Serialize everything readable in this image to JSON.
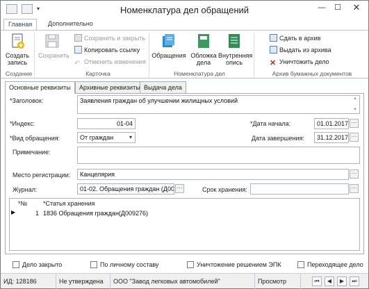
{
  "window": {
    "title": "Номенклатура дел обращений"
  },
  "ribbon": {
    "tabs": [
      "Главная",
      "Дополнительно"
    ],
    "create": {
      "label": "Создать запись"
    },
    "save": {
      "label": "Сохранить"
    },
    "save_close": "Сохранить и закрыть",
    "copy_link": "Копировать ссылку",
    "cancel_changes": "Отменить изменения",
    "appeals": "Обращения",
    "cover": "Обложка дела",
    "inner_list": "Внутренняя опись",
    "to_archive": "Сдать в архив",
    "from_archive": "Выдать из архива",
    "destroy": "Уничтожить дело",
    "groups": {
      "creation": "Создание",
      "card": "Карточка",
      "nomenclature": "Номенклатура дел",
      "archive": "Архив бумажных документов"
    }
  },
  "form_tabs": [
    "Основные реквизиты",
    "Архивные реквизиты",
    "Выдача дела"
  ],
  "form": {
    "title_label": "*Заголовок:",
    "title_value": "Заявления граждан об улучшении жилищных условий",
    "index_label": "*Индекс:",
    "index_value": "01-04",
    "start_label": "*Дата начала:",
    "start_value": "01.01.2017",
    "kind_label": "*Вид обращения:",
    "kind_value": "От граждан",
    "end_label": "Дата завершения:",
    "end_value": "31.12.2017",
    "note_label": "Примечание:",
    "note_value": "",
    "reg_label": "Место регистрации:",
    "reg_value": "Канцелярия",
    "journal_label": "Журнал:",
    "journal_value": "01-02. Обращения граждан (Д000",
    "retention_label": "Срок хранения:",
    "retention_value": ""
  },
  "grid": {
    "headers": [
      "*№",
      "*Статья хранения"
    ],
    "rows": [
      {
        "num": "1",
        "article": "1836 Обращения граждан(Д009276)"
      }
    ]
  },
  "checkboxes": [
    "Дело закрыто",
    "По личному составу",
    "Уничтожение решением ЭПК",
    "Переходящее дело"
  ],
  "status": {
    "id": "ИД: 128186",
    "state": "Не утверждена",
    "org": "ООО \"Завод легковых автомобилей\"",
    "mode": "Просмотр"
  }
}
